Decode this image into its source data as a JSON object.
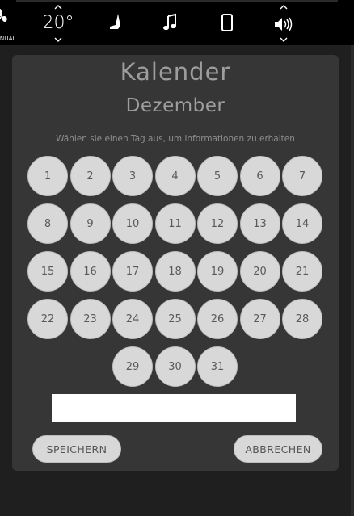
{
  "topbar": {
    "fan_mode_label": "NUAL",
    "temperature": "20°",
    "icons": [
      "fan-icon",
      "caret-up-icon",
      "caret-down-icon",
      "seat-icon",
      "music-note-icon",
      "phone-icon",
      "volume-icon"
    ]
  },
  "calendar": {
    "title": "Kalender",
    "month": "Dezember",
    "hint": "Wählen sie einen Tag aus, um informationen zu erhalten",
    "days": [
      "1",
      "2",
      "3",
      "4",
      "5",
      "6",
      "7",
      "8",
      "9",
      "10",
      "11",
      "12",
      "13",
      "14",
      "15",
      "16",
      "17",
      "18",
      "19",
      "20",
      "21",
      "22",
      "23",
      "24",
      "25",
      "26",
      "27",
      "28",
      "29",
      "30",
      "31"
    ],
    "info_value": "",
    "save_label": "SPEICHERN",
    "cancel_label": "ABBRECHEN"
  },
  "colors": {
    "bar_bg": "#000000",
    "page_bg": "#1f1f1f",
    "card_bg": "#363636",
    "day_fill": "#d8d8d8",
    "heading_text": "#9e9e9e"
  }
}
